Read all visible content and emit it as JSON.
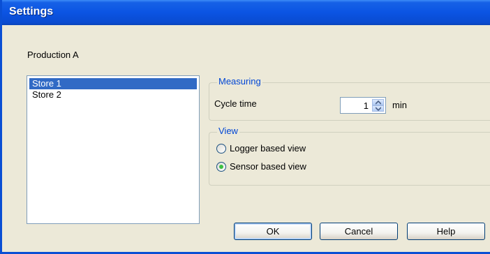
{
  "window": {
    "title": "Settings"
  },
  "group": {
    "title": "Production A"
  },
  "stores": [
    {
      "label": "Store 1",
      "selected": true
    },
    {
      "label": "Store 2",
      "selected": false
    }
  ],
  "measuring": {
    "legend": "Measuring",
    "cycle_time_label": "Cycle time",
    "cycle_time_value": "1",
    "unit": "min"
  },
  "view": {
    "legend": "View",
    "options": [
      {
        "label": "Logger based view",
        "checked": false
      },
      {
        "label": "Sensor based view",
        "checked": true
      }
    ]
  },
  "buttons": {
    "ok": "OK",
    "cancel": "Cancel",
    "help": "Help"
  },
  "colors": {
    "title_bar": "#0b54e3",
    "selection": "#316ac5",
    "legend_text": "#0046d5",
    "dialog_bg": "#ece9d8"
  }
}
